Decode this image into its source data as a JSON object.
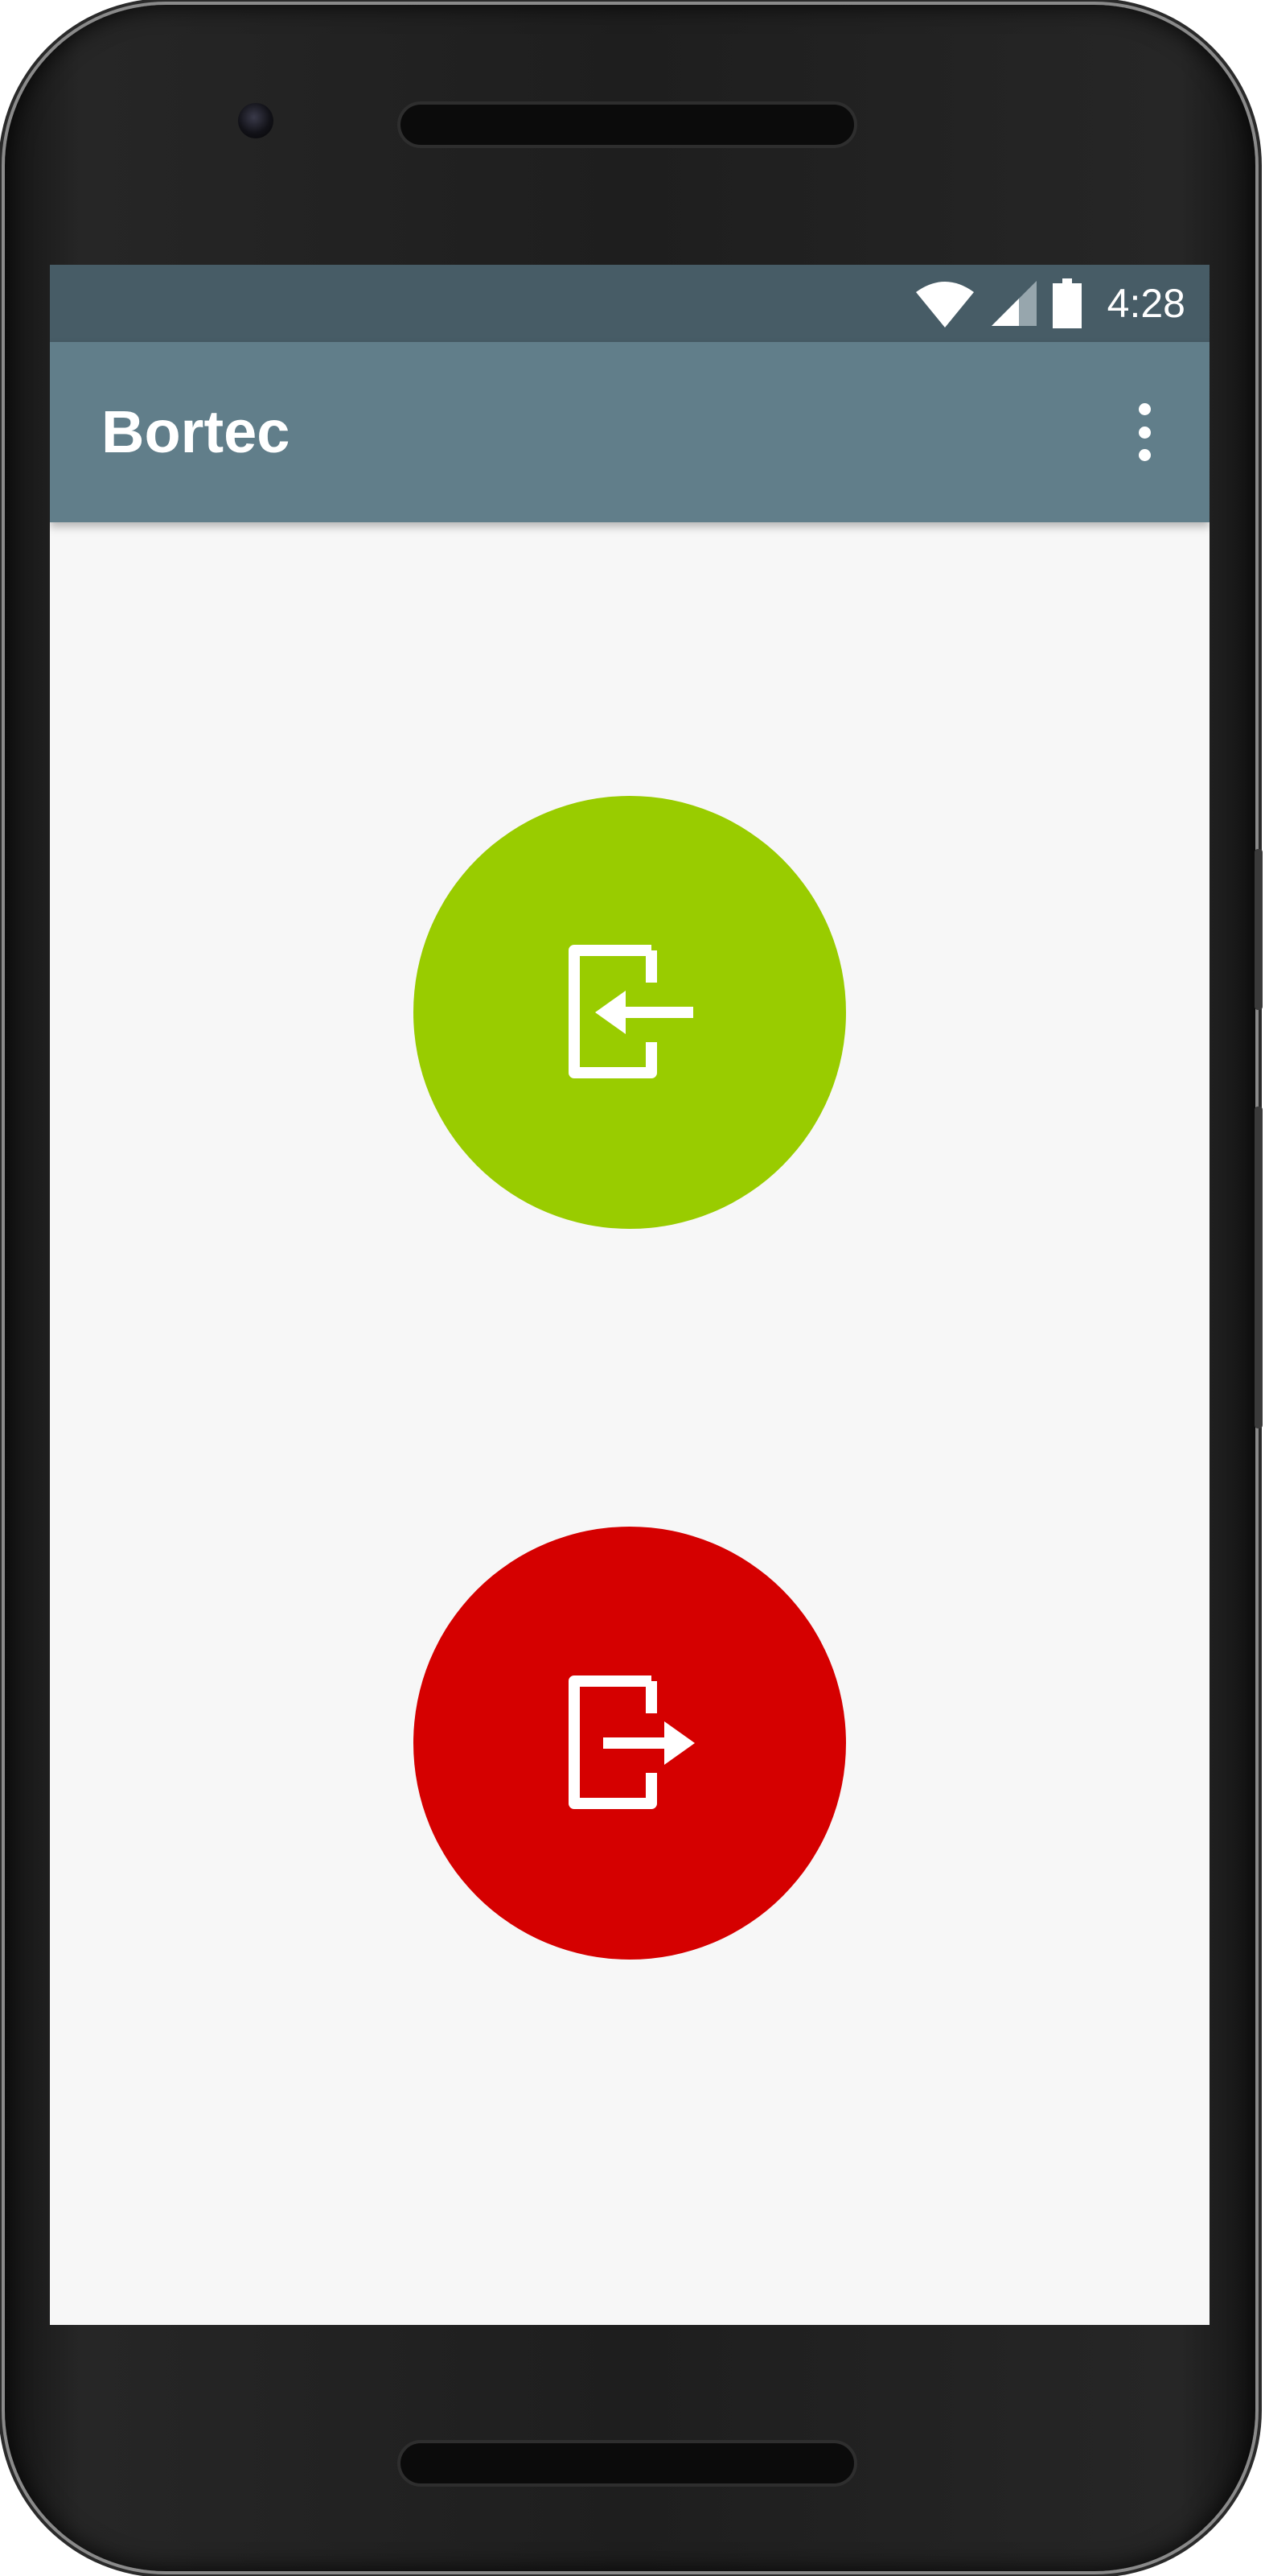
{
  "status_bar": {
    "time": "4:28",
    "icons": [
      "wifi-icon",
      "cell-signal-icon",
      "battery-icon"
    ],
    "background": "#475c66"
  },
  "app_bar": {
    "title": "Bortec",
    "menu_icon": "overflow-menu-icon",
    "background": "#617e8a"
  },
  "actions": [
    {
      "name": "check-in",
      "icon": "login-icon",
      "color": "#99cc00"
    },
    {
      "name": "check-out",
      "icon": "logout-icon",
      "color": "#d50000"
    }
  ],
  "screen_background": "#f7f7f7"
}
